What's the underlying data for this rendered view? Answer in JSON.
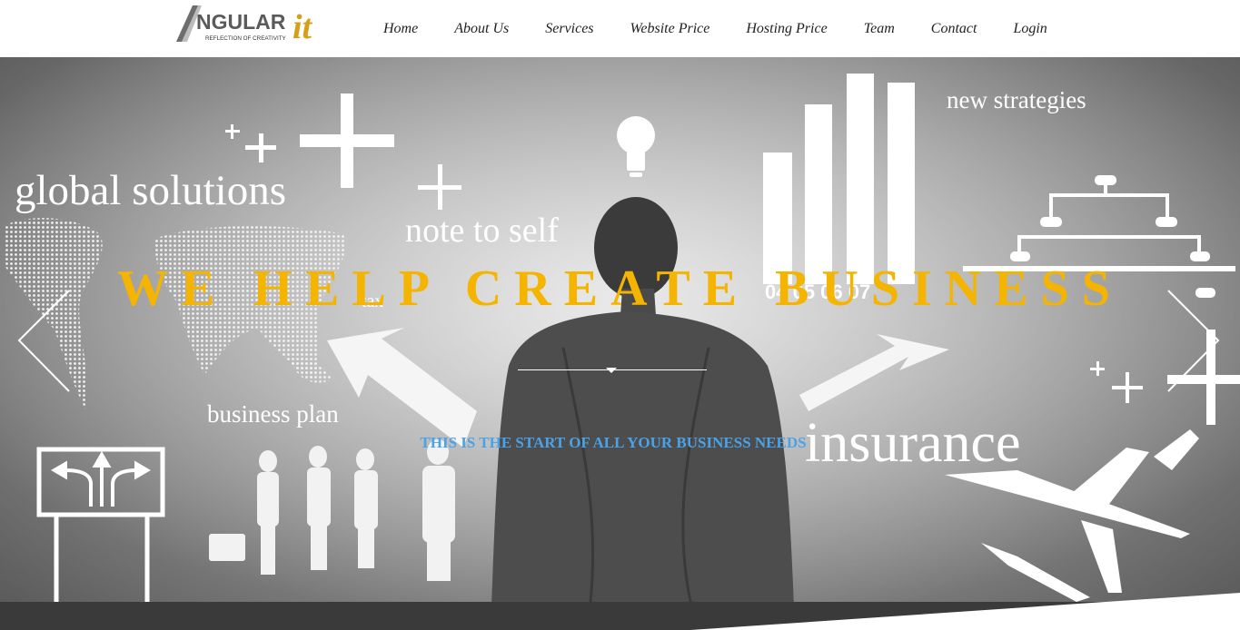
{
  "brand": {
    "logo_text": "NGULAR",
    "logo_suffix": "it",
    "tagline": "REFLECTION OF CREATIVITY"
  },
  "nav": {
    "items": [
      "Home",
      "About Us",
      "Services",
      "Website Price",
      "Hosting Price",
      "Team",
      "Contact",
      "Login"
    ]
  },
  "hero": {
    "headline": "WE HELP CREATE BUSINESS",
    "subheadline": "THIS IS THE START OF ALL YOUR BUSINESS NEEDS",
    "image_text": {
      "global": "global solutions",
      "note": "note to self",
      "tax": "tax",
      "plan": "business plan",
      "strategies": "new strategies",
      "insurance": "insurance",
      "chart_numbers": "04  05  06  07"
    }
  },
  "colors": {
    "headline": "#f4b400",
    "subheadline": "#4aa3e8",
    "logo_accent": "#d4a017"
  },
  "icons": {
    "prev": "chevron-left-icon",
    "next": "chevron-right-icon",
    "lightbulb": "lightbulb-icon",
    "airplane": "airplane-icon"
  }
}
